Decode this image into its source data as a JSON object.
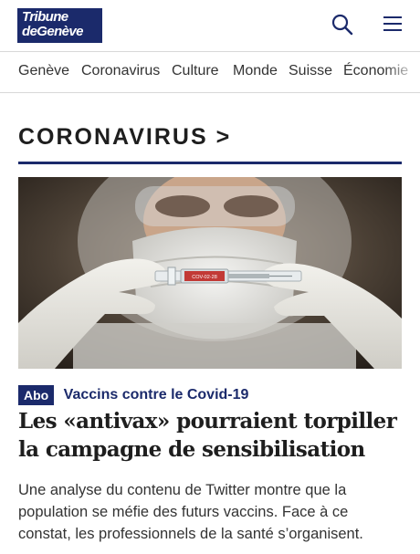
{
  "header": {
    "logo_line1": "Tribune",
    "logo_line2": "deGenève",
    "brand_color": "#1b2a6b",
    "search_icon": "search-icon",
    "menu_icon": "hamburger-menu-icon"
  },
  "nav": {
    "items": [
      "Genève",
      "Coronavirus",
      "Culture",
      "Monde",
      "Suisse",
      "Économie"
    ]
  },
  "section": {
    "title": "CORONAVIRUS >"
  },
  "article": {
    "image_label": "COV-02-28",
    "badge": "Abo",
    "kicker": "Vaccins contre le Covid-19",
    "headline": "Les «antivax» pourraient torpiller la campagne de sensibilisation",
    "summary": "Une analyse du contenu de Twitter montre que la population se méfie des futurs vaccins. Face à ce constat, les professionnels de la santé s’organisent."
  }
}
